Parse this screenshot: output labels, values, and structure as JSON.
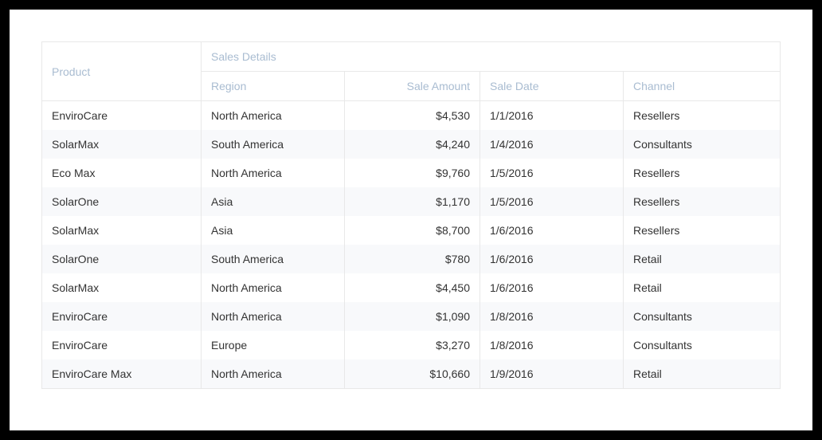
{
  "table": {
    "headers": {
      "product": "Product",
      "salesDetails": "Sales Details",
      "region": "Region",
      "saleAmount": "Sale Amount",
      "saleDate": "Sale Date",
      "channel": "Channel"
    },
    "rows": [
      {
        "product": "EnviroCare",
        "region": "North America",
        "amount": "$4,530",
        "date": "1/1/2016",
        "channel": "Resellers"
      },
      {
        "product": "SolarMax",
        "region": "South America",
        "amount": "$4,240",
        "date": "1/4/2016",
        "channel": "Consultants"
      },
      {
        "product": "Eco Max",
        "region": "North America",
        "amount": "$9,760",
        "date": "1/5/2016",
        "channel": "Resellers"
      },
      {
        "product": "SolarOne",
        "region": "Asia",
        "amount": "$1,170",
        "date": "1/5/2016",
        "channel": "Resellers"
      },
      {
        "product": "SolarMax",
        "region": "Asia",
        "amount": "$8,700",
        "date": "1/6/2016",
        "channel": "Resellers"
      },
      {
        "product": "SolarOne",
        "region": "South America",
        "amount": "$780",
        "date": "1/6/2016",
        "channel": "Retail"
      },
      {
        "product": "SolarMax",
        "region": "North America",
        "amount": "$4,450",
        "date": "1/6/2016",
        "channel": "Retail"
      },
      {
        "product": "EnviroCare",
        "region": "North America",
        "amount": "$1,090",
        "date": "1/8/2016",
        "channel": "Consultants"
      },
      {
        "product": "EnviroCare",
        "region": "Europe",
        "amount": "$3,270",
        "date": "1/8/2016",
        "channel": "Consultants"
      },
      {
        "product": "EnviroCare Max",
        "region": "North America",
        "amount": "$10,660",
        "date": "1/9/2016",
        "channel": "Retail"
      }
    ]
  }
}
